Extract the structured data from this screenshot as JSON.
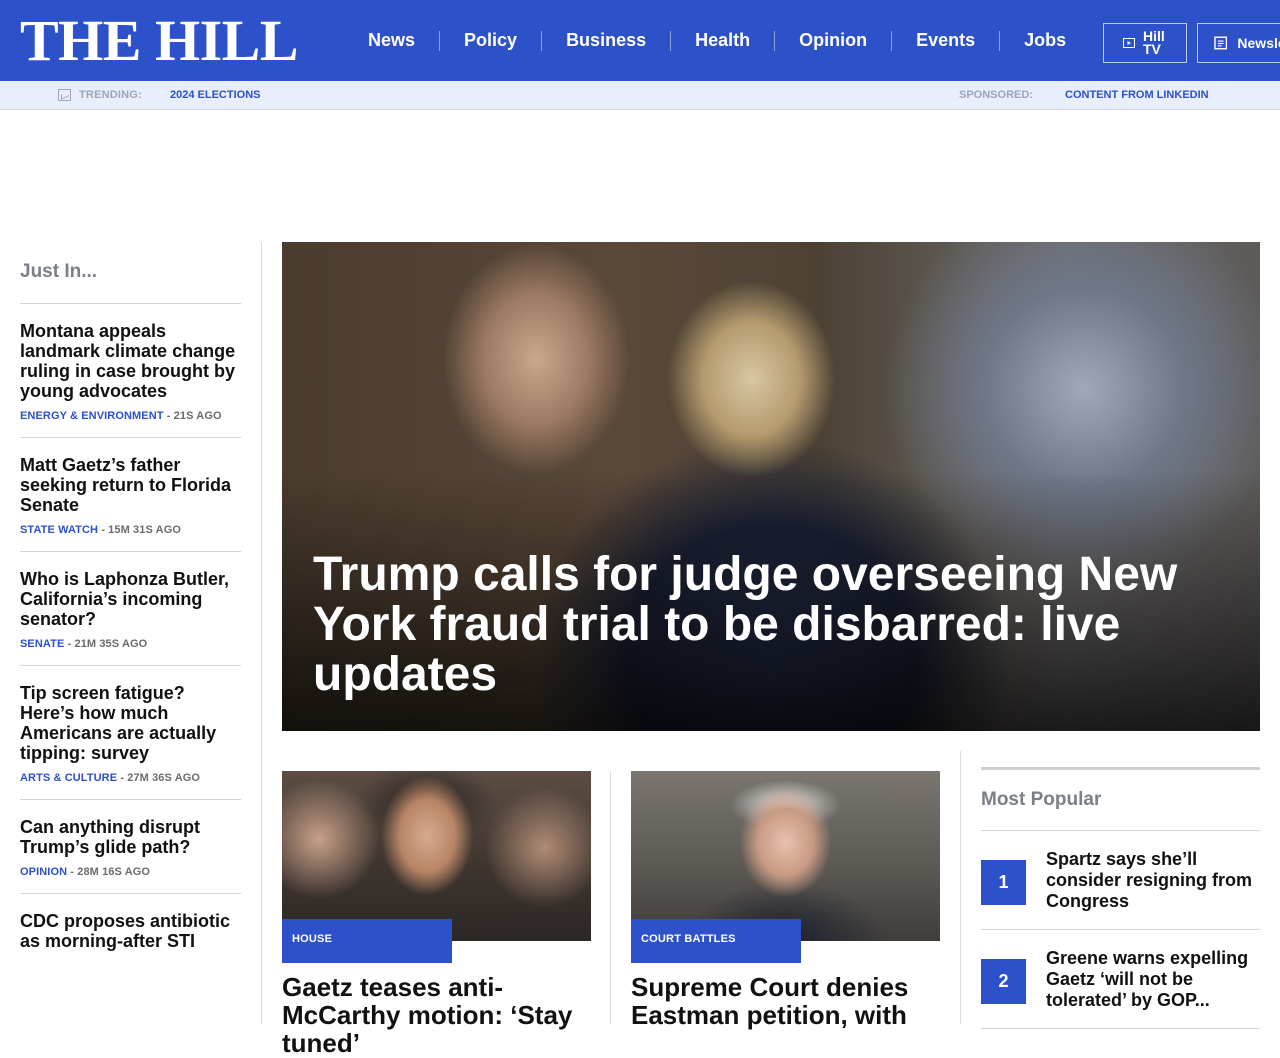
{
  "header": {
    "logo": "THE HILL",
    "nav": [
      "News",
      "Policy",
      "Business",
      "Health",
      "Opinion",
      "Events",
      "Jobs"
    ],
    "hill_tv": "Hill TV",
    "newsletters": "Newsletters"
  },
  "trending": {
    "label": "TRENDING:",
    "link": "2024 ELECTIONS",
    "sponsored_label": "SPONSORED:",
    "sponsored_link": "CONTENT FROM LINKEDIN"
  },
  "just_in": {
    "title": "Just In...",
    "items": [
      {
        "headline": "Montana appeals landmark climate change ruling in case brought by young advocates",
        "category": "ENERGY & ENVIRONMENT",
        "time": " - 21S AGO"
      },
      {
        "headline": "Matt Gaetz’s father seeking return to Florida Senate",
        "category": "STATE WATCH",
        "time": " - 15M 31S AGO"
      },
      {
        "headline": "Who is Laphonza Butler, California’s incoming senator?",
        "category": "SENATE",
        "time": " - 21M 35S AGO"
      },
      {
        "headline": "Tip screen fatigue? Here’s how much Americans are actually tipping: survey",
        "category": "ARTS & CULTURE",
        "time": " - 27M 36S AGO"
      },
      {
        "headline": "Can anything disrupt Trump’s glide path?",
        "category": "OPINION",
        "time": " - 28M 16S AGO"
      },
      {
        "headline": "CDC proposes antibiotic as morning-after STI",
        "category": "",
        "time": ""
      }
    ]
  },
  "hero": {
    "title": "Trump calls for judge overseeing New York fraud trial to be disbarred: live updates"
  },
  "cards": [
    {
      "badge": "HOUSE",
      "headline": "Gaetz teases anti-McCarthy motion: ‘Stay tuned’"
    },
    {
      "badge": "COURT BATTLES",
      "headline": "Supreme Court denies Eastman petition, with"
    }
  ],
  "most_popular": {
    "title": "Most Popular",
    "items": [
      {
        "num": "1",
        "text": "Spartz says she’ll consider resigning from Congress"
      },
      {
        "num": "2",
        "text": "Greene warns expelling Gaetz ‘will not be tolerated’ by GOP..."
      }
    ]
  },
  "colors": {
    "brand_blue": "#2c51c8",
    "muted_gray": "#7a7f88"
  }
}
